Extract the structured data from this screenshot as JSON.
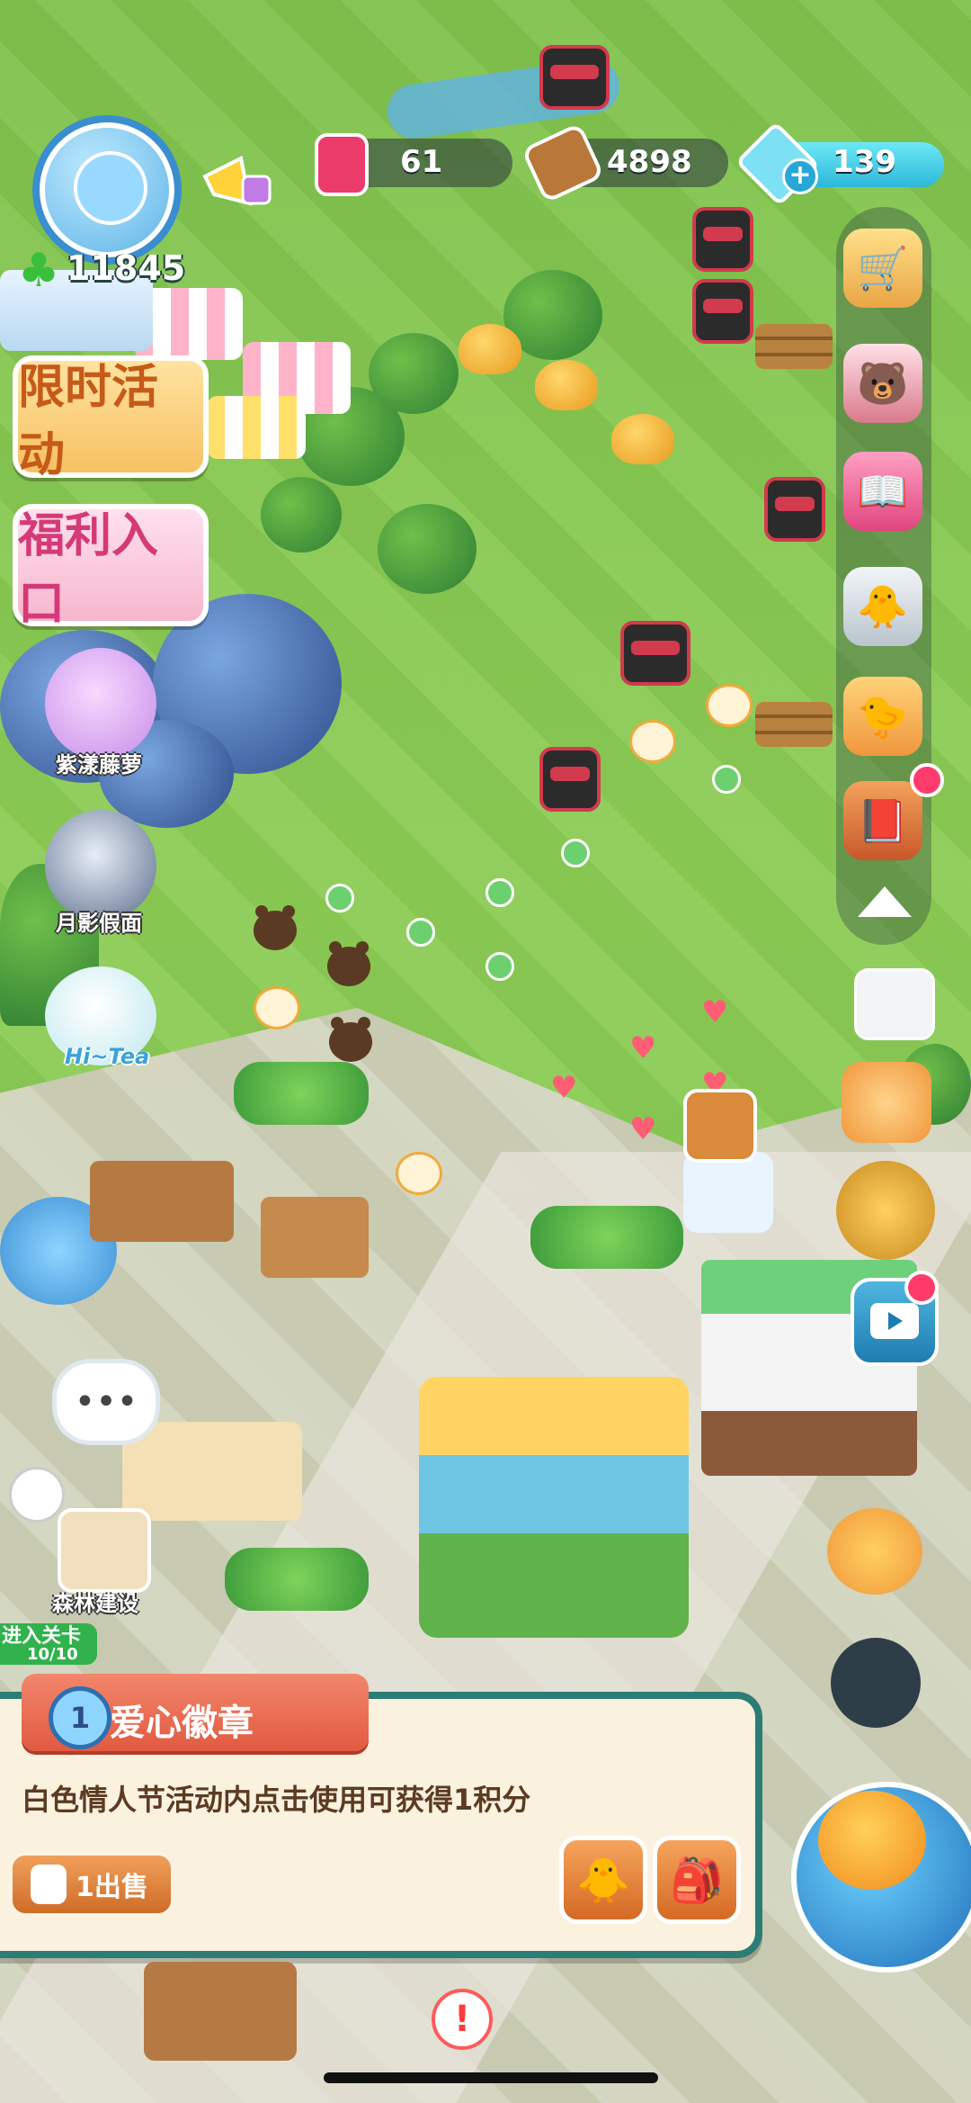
{
  "hud": {
    "jam_count": "61",
    "wood_count": "4898",
    "gem_count": "139",
    "coins": "11845"
  },
  "events": {
    "limited_time": "限时活动",
    "welfare": "福利入口"
  },
  "characters": [
    {
      "label": "紫漾藤萝"
    },
    {
      "label": "月影假面"
    },
    {
      "label": "Hi~Tea"
    }
  ],
  "left_tools": {
    "build_label": "森林建设",
    "enter_level": "进入关卡",
    "level_progress": "10/10"
  },
  "item_card": {
    "badge_number": "1",
    "title": "爱心徽章",
    "description": "白色情人节活动内点击使用可获得1积分",
    "sell_label": "1出售"
  },
  "right_toolbar": [
    {
      "icon": "shop-cart-icon"
    },
    {
      "icon": "bunny-bear-icon"
    },
    {
      "icon": "book-cards-icon"
    },
    {
      "icon": "remote-chick-icon"
    },
    {
      "icon": "chick-hand-icon"
    },
    {
      "icon": "recipe-book-icon"
    }
  ],
  "colors": {
    "grass": "#7fc24c",
    "card_border": "#2b7d75",
    "card_title": "#e15a41",
    "gem_pill": "#2cb8d9"
  }
}
